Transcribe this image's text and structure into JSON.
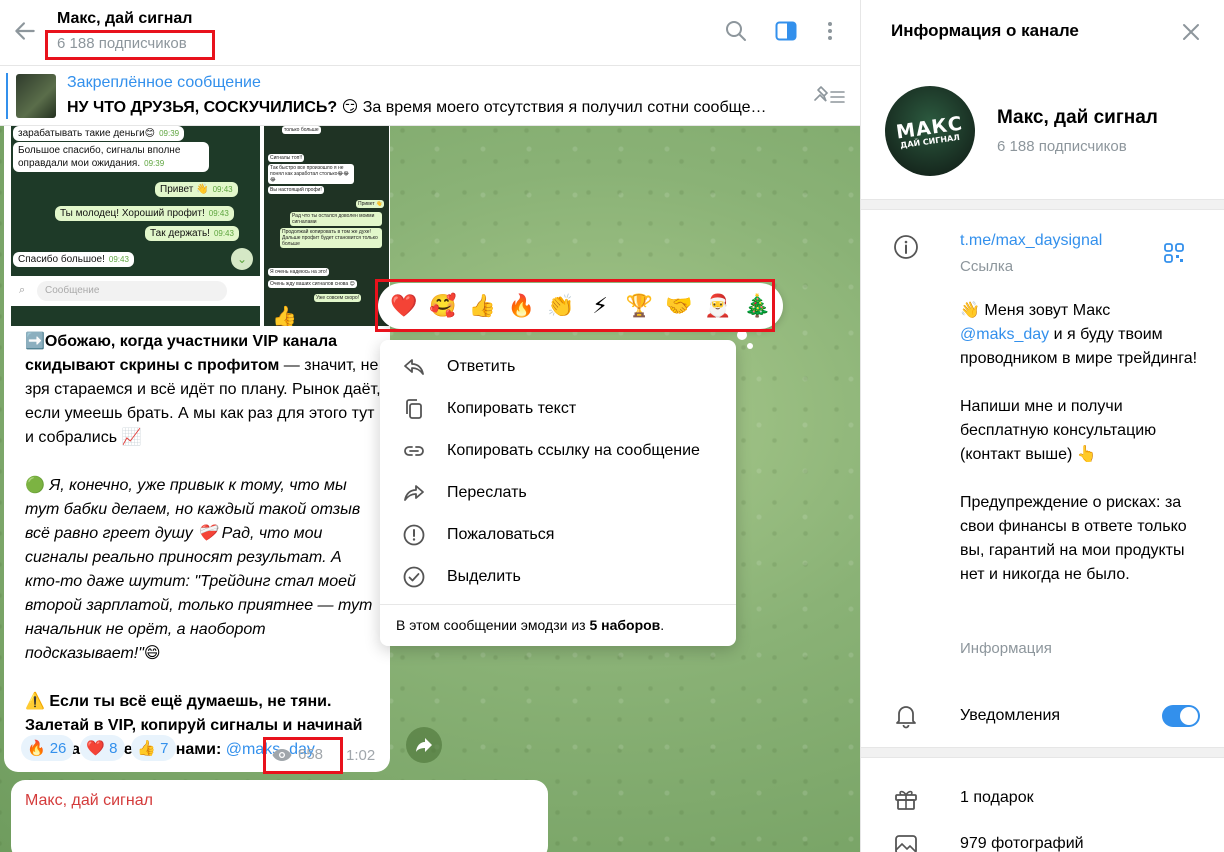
{
  "header": {
    "title": "Макс, дай сигнал",
    "subscribers": "6 188 подписчиков"
  },
  "pinned": {
    "title": "Закреплённое сообщение",
    "text_bold": "НУ ЧТО ДРУЗЬЯ, СОСКУЧИЛИСЬ? 😏",
    "text_rest": " За время моего отсутствия я получил сотни сообще…"
  },
  "photo1_messages": {
    "m1": "зарабатывать такие деньги😊",
    "m1_time": "09:39",
    "m2": "Большое спасибо, сигналы вполне оправдали мои ожидания.",
    "m2_time": "09:39",
    "m3": "Привет 👋",
    "m3_time": "09:43",
    "m4": "Ты молодец! Хороший профит!",
    "m4_time": "09:43",
    "m5": "Так держать!",
    "m5_time": "09:43",
    "m6": "Спасибо большое!",
    "m6_time": "09:43",
    "input_placeholder": "Сообщение"
  },
  "photo2_messages": {
    "m1": "только больше",
    "m2": "Сигналы топ!!",
    "m3": "Так быстро все произошло я не понял как заработал столько😂😂😂",
    "m4": "Вы настоящий профи!",
    "m5": "Привет 👋",
    "m6": "Рад что ты остался доволен моими сигналами",
    "m7": "Продолжай копировать в том же духе! Дальше профит будет становится только больше",
    "m8": "Я очень надеюсь на это!",
    "m9": "Очень жду ваших сигналов снова 😊",
    "m10": "Уже совсем скоро!"
  },
  "message": {
    "p1_icon": "➡️",
    "p1_bold": "Обожаю, когда участники VIP канала скидывают скрины с профитом",
    "p1_rest": " — значит, не зря стараемся и всё идёт по плану. Рынок даёт, если умеешь брать. А мы как раз для этого тут и собрались 📈",
    "p2_icon": "🟢",
    "p2_italic": " Я, конечно, уже привык к тому, что мы тут бабки делаем, но каждый такой отзыв всё равно греет душу ❤️‍🩹 Рад, что мои сигналы реально приносят результат. А кто-то даже шутит: \"Трейдинг стал моей второй зарплатой, только приятнее — тут начальник не орёт, а наоборот подсказывает!\"😄",
    "p3_icon": "⚠️",
    "p3_bold": " Если ты всё ещё думаешь, не тяни. Залетай в VIP, копируй сигналы и начинай забирать вместе с нами: ",
    "p3_link": "@maks_day",
    "reactions": [
      {
        "emoji": "🔥",
        "count": "26"
      },
      {
        "emoji": "❤️",
        "count": "8"
      },
      {
        "emoji": "👍",
        "count": "7"
      }
    ],
    "views": "658",
    "time": "1:02"
  },
  "next_message": {
    "author": "Макс, дай сигнал"
  },
  "reaction_picker": [
    "❤️",
    "🥰",
    "👍",
    "🔥",
    "👏",
    "⚡",
    "🏆",
    "🤝",
    "🎅",
    "🎄"
  ],
  "context_menu": {
    "items": [
      "Ответить",
      "Копировать текст",
      "Копировать ссылку на сообщение",
      "Переслать",
      "Пожаловаться",
      "Выделить"
    ],
    "footer_pre": "В этом сообщении эмодзи из ",
    "footer_bold": "5 наборов",
    "footer_post": "."
  },
  "info": {
    "panel_title": "Информация о канале",
    "avatar_line1": "МАКС",
    "avatar_line2": "ДАЙ СИГНАЛ",
    "name": "Макс, дай сигнал",
    "subscribers": "6 188 подписчиков",
    "link": "t.me/max_daysignal",
    "link_label": "Ссылка",
    "about_p1_pre": "👋 Меня зовут Макс ",
    "about_p1_link": "@maks_day",
    "about_p1_post": " и я буду твоим проводником в мире трейдинга!",
    "about_p2": "Напиши мне и получи бесплатную консультацию (контакт выше) 👆",
    "about_p3": "Предупреждение о рисках: за свои финансы в ответе только вы, гарантий на мои продукты нет и никогда не было.",
    "about_label": "Информация",
    "notifications_label": "Уведомления",
    "notifications_on": true,
    "gifts": "1 подарок",
    "photos": "979 фотографий"
  },
  "colors": {
    "accent": "#3390ec",
    "highlight": "#e8121c",
    "author": "#d43b3b"
  }
}
